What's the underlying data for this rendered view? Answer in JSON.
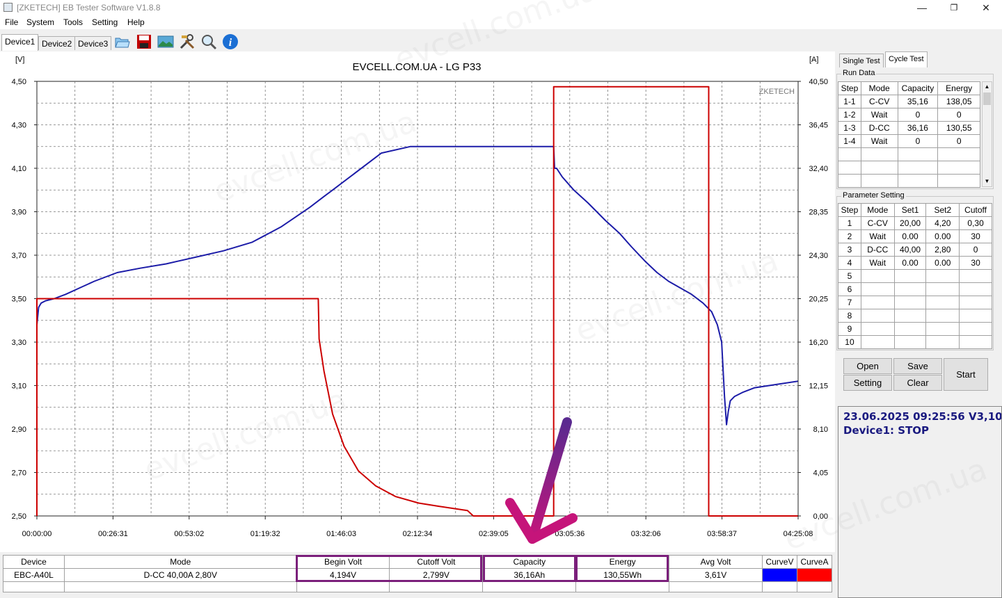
{
  "window": {
    "title": "[ZKETECH] EB Tester Software V1.8.8",
    "buttons": {
      "minimize": "—",
      "restore": "❐",
      "close": "✕"
    }
  },
  "menu": [
    "File",
    "System",
    "Tools",
    "Setting",
    "Help"
  ],
  "device_tabs": [
    "Device1",
    "Device2",
    "Device3"
  ],
  "toolbar_icons": [
    "open-folder-icon",
    "save-icon",
    "image-icon",
    "tools-icon",
    "zoom-icon",
    "info-icon"
  ],
  "info_glyph": "i",
  "chart_data": {
    "type": "line",
    "title": "EVCELL.COM.UA - LG P33",
    "left_unit": "[V]",
    "right_unit": "[A]",
    "brand": "ZKETECH",
    "y_left_ticks": [
      "4,50",
      "4,30",
      "4,10",
      "3,90",
      "3,70",
      "3,50",
      "3,30",
      "3,10",
      "2,90",
      "2,70",
      "2,50"
    ],
    "y_right_ticks": [
      "40,50",
      "36,45",
      "32,40",
      "28,35",
      "24,30",
      "20,25",
      "16,20",
      "12,15",
      "8,10",
      "4,05",
      "0,00"
    ],
    "x_ticks": [
      "00:00:00",
      "00:26:31",
      "00:53:02",
      "01:19:32",
      "01:46:03",
      "02:12:34",
      "02:39:05",
      "03:05:36",
      "03:32:06",
      "03:58:37",
      "04:25:08"
    ],
    "ylim_left": [
      2.5,
      4.5
    ],
    "ylim_right": [
      0,
      40.5
    ],
    "xlim_min": [
      0,
      265.13
    ],
    "grid": true,
    "series": [
      {
        "axis": "left",
        "color": "#1c1ca8",
        "x": [
          0,
          0.6,
          1.5,
          3,
          6,
          10,
          15,
          20,
          28,
          36,
          45,
          55,
          65,
          75,
          85,
          95,
          100,
          103,
          110,
          120,
          130,
          140,
          150,
          152,
          160,
          170,
          180,
          180.3,
          181,
          183,
          187,
          192,
          198,
          203,
          207,
          212,
          216,
          220,
          224,
          228,
          232,
          235,
          237,
          238.5,
          239.5,
          240.2,
          240.8,
          241.5,
          243,
          246,
          250,
          255,
          260,
          265
        ],
        "y": [
          3.38,
          3.46,
          3.48,
          3.49,
          3.5,
          3.52,
          3.55,
          3.58,
          3.62,
          3.64,
          3.66,
          3.69,
          3.72,
          3.76,
          3.83,
          3.92,
          3.97,
          4.0,
          4.07,
          4.17,
          4.2,
          4.2,
          4.2,
          4.2,
          4.2,
          4.2,
          4.2,
          4.1,
          4.1,
          4.06,
          4.0,
          3.94,
          3.86,
          3.8,
          3.74,
          3.67,
          3.62,
          3.58,
          3.55,
          3.52,
          3.48,
          3.44,
          3.38,
          3.3,
          3.05,
          2.92,
          2.98,
          3.03,
          3.05,
          3.07,
          3.09,
          3.1,
          3.11,
          3.12
        ]
      },
      {
        "axis": "right",
        "color": "#cc0000",
        "x": [
          0,
          0,
          98,
          98.3,
          100,
          103,
          107,
          112,
          118,
          125,
          133,
          140,
          150,
          152,
          160,
          169,
          180,
          180,
          234,
          234,
          265
        ],
        "y": [
          0,
          20.25,
          20.25,
          16.5,
          13.5,
          9.5,
          6.5,
          4.2,
          2.8,
          1.8,
          1.2,
          0.9,
          0.5,
          0.0,
          0.0,
          0.0,
          0.0,
          40.0,
          40.0,
          0.0,
          0.0
        ]
      }
    ]
  },
  "panel": {
    "tabs": [
      "Single Test",
      "Cycle Test"
    ],
    "run_data": {
      "label": "Run Data",
      "headers": [
        "Step",
        "Mode",
        "Capacity",
        "Energy"
      ],
      "rows": [
        [
          "1-1",
          "C-CV",
          "35,16",
          "138,05"
        ],
        [
          "1-2",
          "Wait",
          "0",
          "0"
        ],
        [
          "1-3",
          "D-CC",
          "36,16",
          "130,55"
        ],
        [
          "1-4",
          "Wait",
          "0",
          "0"
        ]
      ]
    },
    "parameter": {
      "label": "Parameter Setting",
      "headers": [
        "Step",
        "Mode",
        "Set1",
        "Set2",
        "Cutoff"
      ],
      "rows": [
        [
          "1",
          "C-CV",
          "20,00",
          "4,20",
          "0,30"
        ],
        [
          "2",
          "Wait",
          "0.00",
          "0.00",
          "30"
        ],
        [
          "3",
          "D-CC",
          "40,00",
          "2,80",
          "0"
        ],
        [
          "4",
          "Wait",
          "0.00",
          "0.00",
          "30"
        ],
        [
          "5",
          "",
          "",
          "",
          ""
        ],
        [
          "6",
          "",
          "",
          "",
          ""
        ],
        [
          "7",
          "",
          "",
          "",
          ""
        ],
        [
          "8",
          "",
          "",
          "",
          ""
        ],
        [
          "9",
          "",
          "",
          "",
          ""
        ],
        [
          "10",
          "",
          "",
          "",
          ""
        ]
      ]
    },
    "buttons": {
      "open": "Open",
      "save": "Save",
      "setting": "Setting",
      "clear": "Clear",
      "start": "Start"
    }
  },
  "status": {
    "datetime": "23.06.2025 09:25:56  V3,10",
    "device": "Device1: STOP"
  },
  "summary": {
    "headers": [
      "Device",
      "Mode",
      "Begin Volt",
      "Cutoff Volt",
      "Capacity",
      "Energy",
      "Avg Volt",
      "CurveV",
      "CurveA"
    ],
    "values": [
      "EBC-A40L",
      "D-CC  40,00A  2,80V",
      "4,194V",
      "2,799V",
      "36,16Ah",
      "130,55Wh",
      "3,61V",
      "",
      ""
    ],
    "curve_colors": {
      "v": "#0000ff",
      "a": "#ff0000"
    },
    "highlight_color": "#7b1f7b",
    "arrow_color": "#7d2aa0"
  },
  "watermark": "evcell.com.ua"
}
